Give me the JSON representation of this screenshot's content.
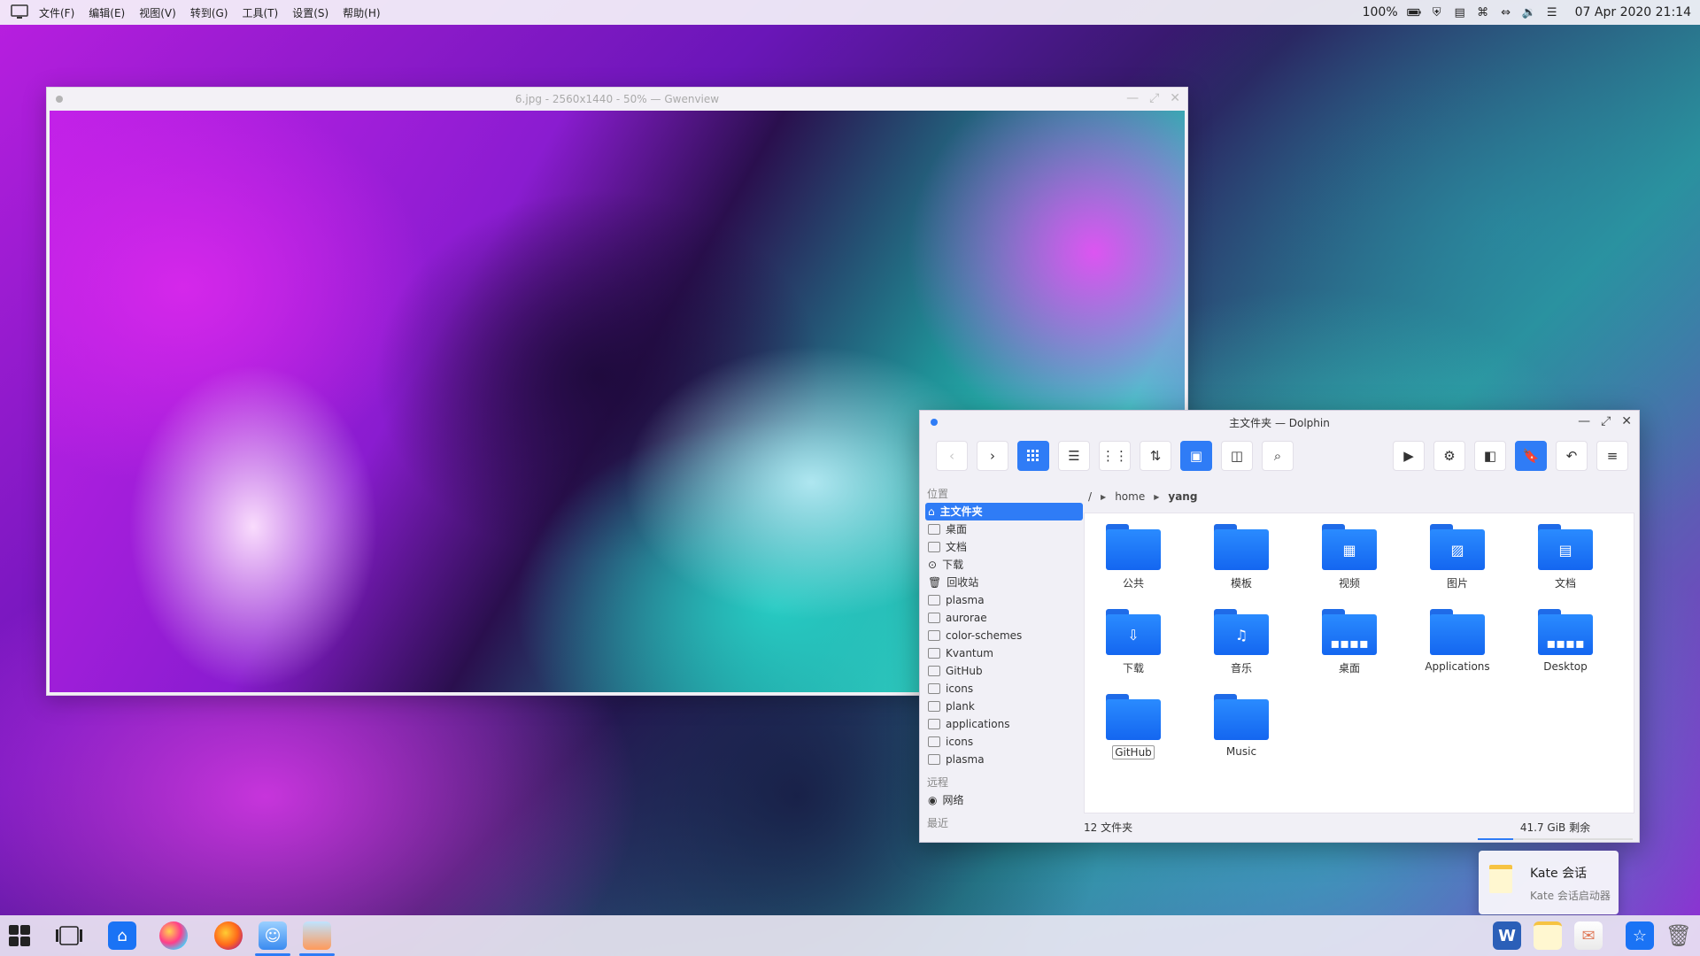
{
  "top_panel": {
    "menus": [
      "文件(F)",
      "编辑(E)",
      "视图(V)",
      "转到(G)",
      "工具(T)",
      "设置(S)",
      "帮助(H)"
    ],
    "battery": "100%",
    "datetime": "07 Apr 2020 21:14"
  },
  "gwenview": {
    "title": "6.jpg - 2560x1440 - 50% — Gwenview"
  },
  "dolphin": {
    "title": "主文件夹 — Dolphin",
    "places_header": "位置",
    "remote_header": "远程",
    "recent_header": "最近",
    "places": [
      "主文件夹",
      "桌面",
      "文档",
      "下载",
      "回收站",
      "plasma",
      "aurorae",
      "color-schemes",
      "Kvantum",
      "GitHub",
      "icons",
      "plank",
      "applications",
      "icons",
      "plasma"
    ],
    "remote": [
      "网络"
    ],
    "breadcrumb": {
      "root": "/",
      "parent": "home",
      "current": "yang"
    },
    "files": [
      "公共",
      "模板",
      "视频",
      "图片",
      "文档",
      "下载",
      "音乐",
      "桌面",
      "Applications",
      "Desktop",
      "GitHub",
      "Music"
    ],
    "status_count": "12 文件夹",
    "free_space": "41.7 GiB 剩余",
    "free_space_used_fraction": 0.23
  },
  "notification": {
    "title": "Kate 会话",
    "subtitle": "Kate 会话启动器"
  },
  "colors": {
    "accent": "#2f7cf6",
    "folder": "#1a73f5"
  }
}
